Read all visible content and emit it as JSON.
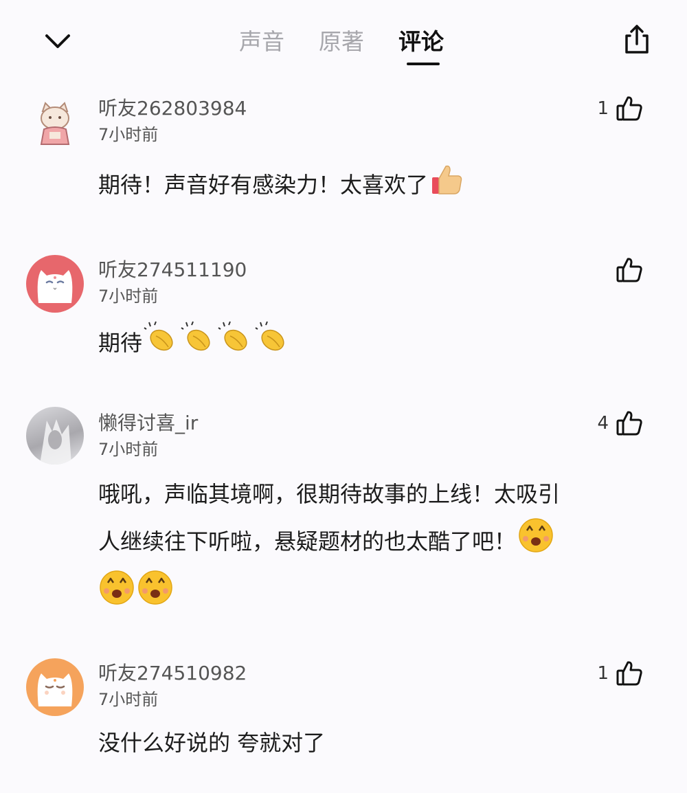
{
  "header": {
    "tabs": [
      {
        "label": "声音",
        "active": false
      },
      {
        "label": "原著",
        "active": false
      },
      {
        "label": "评论",
        "active": true
      }
    ]
  },
  "comments": [
    {
      "username": "听友262803984",
      "time": "7小时前",
      "likes": "1",
      "text": "期待！声音好有感染力！太喜欢了",
      "emoji": "thumbs-up-emoji"
    },
    {
      "username": "听友274511190",
      "time": "7小时前",
      "likes": "",
      "text": "期待",
      "emoji": "clapping-hands-emoji x4"
    },
    {
      "username": "懒得讨喜_ir",
      "time": "7小时前",
      "likes": "4",
      "text_line1": "哦吼，声临其境啊，很期待故事的上线！太吸引",
      "text_line2": "人继续往下听啦，悬疑题材的也太酷了吧！",
      "emoji": "excited-face-emoji x3"
    },
    {
      "username": "听友274510982",
      "time": "7小时前",
      "likes": "1",
      "text": "没什么好说的 夸就对了"
    }
  ]
}
